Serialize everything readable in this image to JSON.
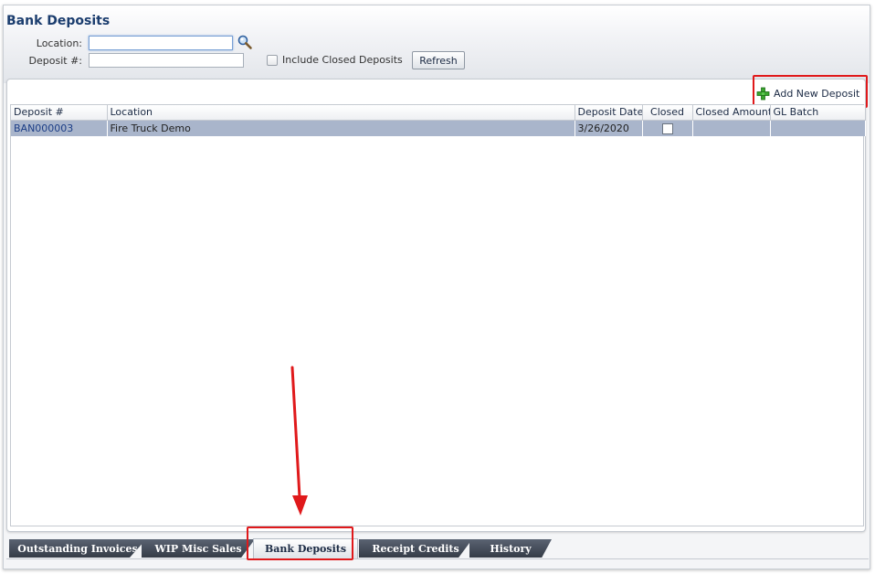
{
  "page": {
    "title": "Bank Deposits"
  },
  "filters": {
    "location_label": "Location:",
    "location_value": "",
    "deposit_label": "Deposit #:",
    "deposit_value": "",
    "include_closed_label": "Include Closed Deposits",
    "include_closed_checked": false,
    "refresh_label": "Refresh",
    "search_icon": "magnifier-icon"
  },
  "toolbar": {
    "add_label": "Add New Deposit",
    "add_icon": "green-plus-icon"
  },
  "grid": {
    "columns": [
      "Deposit #",
      "Location",
      "Deposit Date",
      "Closed",
      "Closed Amount",
      "GL Batch"
    ],
    "rows": [
      {
        "deposit": "BAN000003",
        "location": "Fire Truck Demo",
        "date": "3/26/2020",
        "closed": false,
        "closed_amount": "",
        "gl_batch": ""
      }
    ]
  },
  "tabs": [
    {
      "label": "Outstanding Invoices",
      "active": false
    },
    {
      "label": "WIP Misc Sales",
      "active": false
    },
    {
      "label": "Bank Deposits",
      "active": true
    },
    {
      "label": "Receipt Credits",
      "active": false
    },
    {
      "label": "History",
      "active": false
    }
  ],
  "colors": {
    "title": "#1b3d6e",
    "row_selected": "#a9b5cb",
    "annotation_red": "#e0191b",
    "tab_dark": "#353c47"
  }
}
